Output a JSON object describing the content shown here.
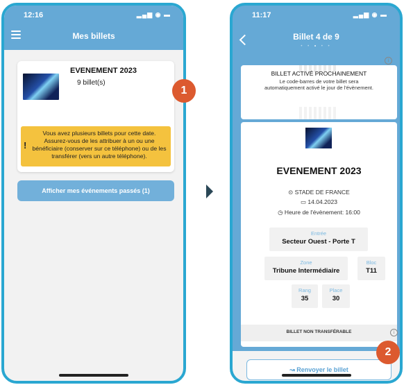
{
  "left": {
    "status_time": "12:16",
    "status_icons": "▂▄▆ ◉ ▬",
    "title": "Mes billets",
    "ticket": {
      "event_name": "EVENEMENT 2023",
      "count": "9 billet(s)",
      "warning_icon": "!",
      "warning": "Vous avez plusieurs billets pour cette date. Assurez-vous de les attribuer à un ou une bénéficiaire (conserver sur ce téléphone) ou de les transférer (vers un autre téléphone)."
    },
    "past_events_button": "Afficher mes événements passés (1)"
  },
  "right": {
    "status_time": "11:17",
    "status_icons": "▂▄▆ ◉ ▬",
    "title": "Billet 4 de 9",
    "dots": [
      "•",
      "•",
      "•",
      "•",
      "•"
    ],
    "active_dot_index": 2,
    "activation": {
      "title": "BILLET ACTIVÉ PROCHAINEMENT",
      "text": "Le code-barres de votre billet sera automatiquement activé le jour de l'évènement.",
      "info_icon": "i"
    },
    "event_name": "EVENEMENT 2023",
    "venue": "⊙ STADE DE FRANCE",
    "date": "▭ 14.04.2023",
    "time": "◷ Heure de l'évènement: 16:00",
    "entry_label": "Entrée",
    "entry_value": "Secteur Ouest - Porte T",
    "zone_label": "Zone",
    "zone_value": "Tribune Intermédiaire",
    "bloc_label": "Bloc",
    "bloc_value": "T11",
    "rang_label": "Rang",
    "rang_value": "35",
    "place_label": "Place",
    "place_value": "30",
    "non_transferable": "BILLET NON TRANSFÉRABLE",
    "resend_button": "↝ Renvoyer le billet"
  },
  "badges": {
    "first": "1",
    "second": "2"
  },
  "colors": {
    "header_blue": "#65a9d6",
    "frame_blue": "#2aa7d1",
    "warning_yellow": "#f4c23e",
    "badge_orange": "#dc5a2f"
  }
}
